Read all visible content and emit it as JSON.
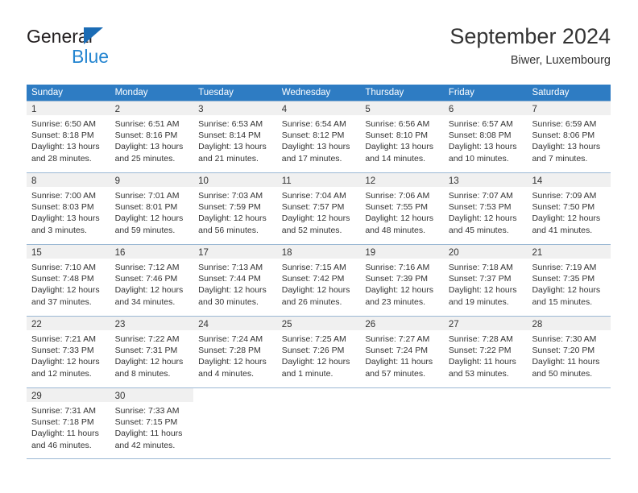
{
  "brand": {
    "name_top": "General",
    "name_bottom": "Blue",
    "accent_color": "#2485d0",
    "triangle_color": "#1b6cb5"
  },
  "header": {
    "title": "September 2024",
    "subtitle": "Biwer, Luxembourg"
  },
  "calendar": {
    "header_bg": "#2e7cc3",
    "day_band_bg": "#f0f0f0",
    "weekdays": [
      "Sunday",
      "Monday",
      "Tuesday",
      "Wednesday",
      "Thursday",
      "Friday",
      "Saturday"
    ],
    "weeks": [
      [
        {
          "day": "1",
          "sunrise": "Sunrise: 6:50 AM",
          "sunset": "Sunset: 8:18 PM",
          "daylight1": "Daylight: 13 hours",
          "daylight2": "and 28 minutes."
        },
        {
          "day": "2",
          "sunrise": "Sunrise: 6:51 AM",
          "sunset": "Sunset: 8:16 PM",
          "daylight1": "Daylight: 13 hours",
          "daylight2": "and 25 minutes."
        },
        {
          "day": "3",
          "sunrise": "Sunrise: 6:53 AM",
          "sunset": "Sunset: 8:14 PM",
          "daylight1": "Daylight: 13 hours",
          "daylight2": "and 21 minutes."
        },
        {
          "day": "4",
          "sunrise": "Sunrise: 6:54 AM",
          "sunset": "Sunset: 8:12 PM",
          "daylight1": "Daylight: 13 hours",
          "daylight2": "and 17 minutes."
        },
        {
          "day": "5",
          "sunrise": "Sunrise: 6:56 AM",
          "sunset": "Sunset: 8:10 PM",
          "daylight1": "Daylight: 13 hours",
          "daylight2": "and 14 minutes."
        },
        {
          "day": "6",
          "sunrise": "Sunrise: 6:57 AM",
          "sunset": "Sunset: 8:08 PM",
          "daylight1": "Daylight: 13 hours",
          "daylight2": "and 10 minutes."
        },
        {
          "day": "7",
          "sunrise": "Sunrise: 6:59 AM",
          "sunset": "Sunset: 8:06 PM",
          "daylight1": "Daylight: 13 hours",
          "daylight2": "and 7 minutes."
        }
      ],
      [
        {
          "day": "8",
          "sunrise": "Sunrise: 7:00 AM",
          "sunset": "Sunset: 8:03 PM",
          "daylight1": "Daylight: 13 hours",
          "daylight2": "and 3 minutes."
        },
        {
          "day": "9",
          "sunrise": "Sunrise: 7:01 AM",
          "sunset": "Sunset: 8:01 PM",
          "daylight1": "Daylight: 12 hours",
          "daylight2": "and 59 minutes."
        },
        {
          "day": "10",
          "sunrise": "Sunrise: 7:03 AM",
          "sunset": "Sunset: 7:59 PM",
          "daylight1": "Daylight: 12 hours",
          "daylight2": "and 56 minutes."
        },
        {
          "day": "11",
          "sunrise": "Sunrise: 7:04 AM",
          "sunset": "Sunset: 7:57 PM",
          "daylight1": "Daylight: 12 hours",
          "daylight2": "and 52 minutes."
        },
        {
          "day": "12",
          "sunrise": "Sunrise: 7:06 AM",
          "sunset": "Sunset: 7:55 PM",
          "daylight1": "Daylight: 12 hours",
          "daylight2": "and 48 minutes."
        },
        {
          "day": "13",
          "sunrise": "Sunrise: 7:07 AM",
          "sunset": "Sunset: 7:53 PM",
          "daylight1": "Daylight: 12 hours",
          "daylight2": "and 45 minutes."
        },
        {
          "day": "14",
          "sunrise": "Sunrise: 7:09 AM",
          "sunset": "Sunset: 7:50 PM",
          "daylight1": "Daylight: 12 hours",
          "daylight2": "and 41 minutes."
        }
      ],
      [
        {
          "day": "15",
          "sunrise": "Sunrise: 7:10 AM",
          "sunset": "Sunset: 7:48 PM",
          "daylight1": "Daylight: 12 hours",
          "daylight2": "and 37 minutes."
        },
        {
          "day": "16",
          "sunrise": "Sunrise: 7:12 AM",
          "sunset": "Sunset: 7:46 PM",
          "daylight1": "Daylight: 12 hours",
          "daylight2": "and 34 minutes."
        },
        {
          "day": "17",
          "sunrise": "Sunrise: 7:13 AM",
          "sunset": "Sunset: 7:44 PM",
          "daylight1": "Daylight: 12 hours",
          "daylight2": "and 30 minutes."
        },
        {
          "day": "18",
          "sunrise": "Sunrise: 7:15 AM",
          "sunset": "Sunset: 7:42 PM",
          "daylight1": "Daylight: 12 hours",
          "daylight2": "and 26 minutes."
        },
        {
          "day": "19",
          "sunrise": "Sunrise: 7:16 AM",
          "sunset": "Sunset: 7:39 PM",
          "daylight1": "Daylight: 12 hours",
          "daylight2": "and 23 minutes."
        },
        {
          "day": "20",
          "sunrise": "Sunrise: 7:18 AM",
          "sunset": "Sunset: 7:37 PM",
          "daylight1": "Daylight: 12 hours",
          "daylight2": "and 19 minutes."
        },
        {
          "day": "21",
          "sunrise": "Sunrise: 7:19 AM",
          "sunset": "Sunset: 7:35 PM",
          "daylight1": "Daylight: 12 hours",
          "daylight2": "and 15 minutes."
        }
      ],
      [
        {
          "day": "22",
          "sunrise": "Sunrise: 7:21 AM",
          "sunset": "Sunset: 7:33 PM",
          "daylight1": "Daylight: 12 hours",
          "daylight2": "and 12 minutes."
        },
        {
          "day": "23",
          "sunrise": "Sunrise: 7:22 AM",
          "sunset": "Sunset: 7:31 PM",
          "daylight1": "Daylight: 12 hours",
          "daylight2": "and 8 minutes."
        },
        {
          "day": "24",
          "sunrise": "Sunrise: 7:24 AM",
          "sunset": "Sunset: 7:28 PM",
          "daylight1": "Daylight: 12 hours",
          "daylight2": "and 4 minutes."
        },
        {
          "day": "25",
          "sunrise": "Sunrise: 7:25 AM",
          "sunset": "Sunset: 7:26 PM",
          "daylight1": "Daylight: 12 hours",
          "daylight2": "and 1 minute."
        },
        {
          "day": "26",
          "sunrise": "Sunrise: 7:27 AM",
          "sunset": "Sunset: 7:24 PM",
          "daylight1": "Daylight: 11 hours",
          "daylight2": "and 57 minutes."
        },
        {
          "day": "27",
          "sunrise": "Sunrise: 7:28 AM",
          "sunset": "Sunset: 7:22 PM",
          "daylight1": "Daylight: 11 hours",
          "daylight2": "and 53 minutes."
        },
        {
          "day": "28",
          "sunrise": "Sunrise: 7:30 AM",
          "sunset": "Sunset: 7:20 PM",
          "daylight1": "Daylight: 11 hours",
          "daylight2": "and 50 minutes."
        }
      ],
      [
        {
          "day": "29",
          "sunrise": "Sunrise: 7:31 AM",
          "sunset": "Sunset: 7:18 PM",
          "daylight1": "Daylight: 11 hours",
          "daylight2": "and 46 minutes."
        },
        {
          "day": "30",
          "sunrise": "Sunrise: 7:33 AM",
          "sunset": "Sunset: 7:15 PM",
          "daylight1": "Daylight: 11 hours",
          "daylight2": "and 42 minutes."
        },
        {
          "day": "",
          "sunrise": "",
          "sunset": "",
          "daylight1": "",
          "daylight2": ""
        },
        {
          "day": "",
          "sunrise": "",
          "sunset": "",
          "daylight1": "",
          "daylight2": ""
        },
        {
          "day": "",
          "sunrise": "",
          "sunset": "",
          "daylight1": "",
          "daylight2": ""
        },
        {
          "day": "",
          "sunrise": "",
          "sunset": "",
          "daylight1": "",
          "daylight2": ""
        },
        {
          "day": "",
          "sunrise": "",
          "sunset": "",
          "daylight1": "",
          "daylight2": ""
        }
      ]
    ]
  }
}
